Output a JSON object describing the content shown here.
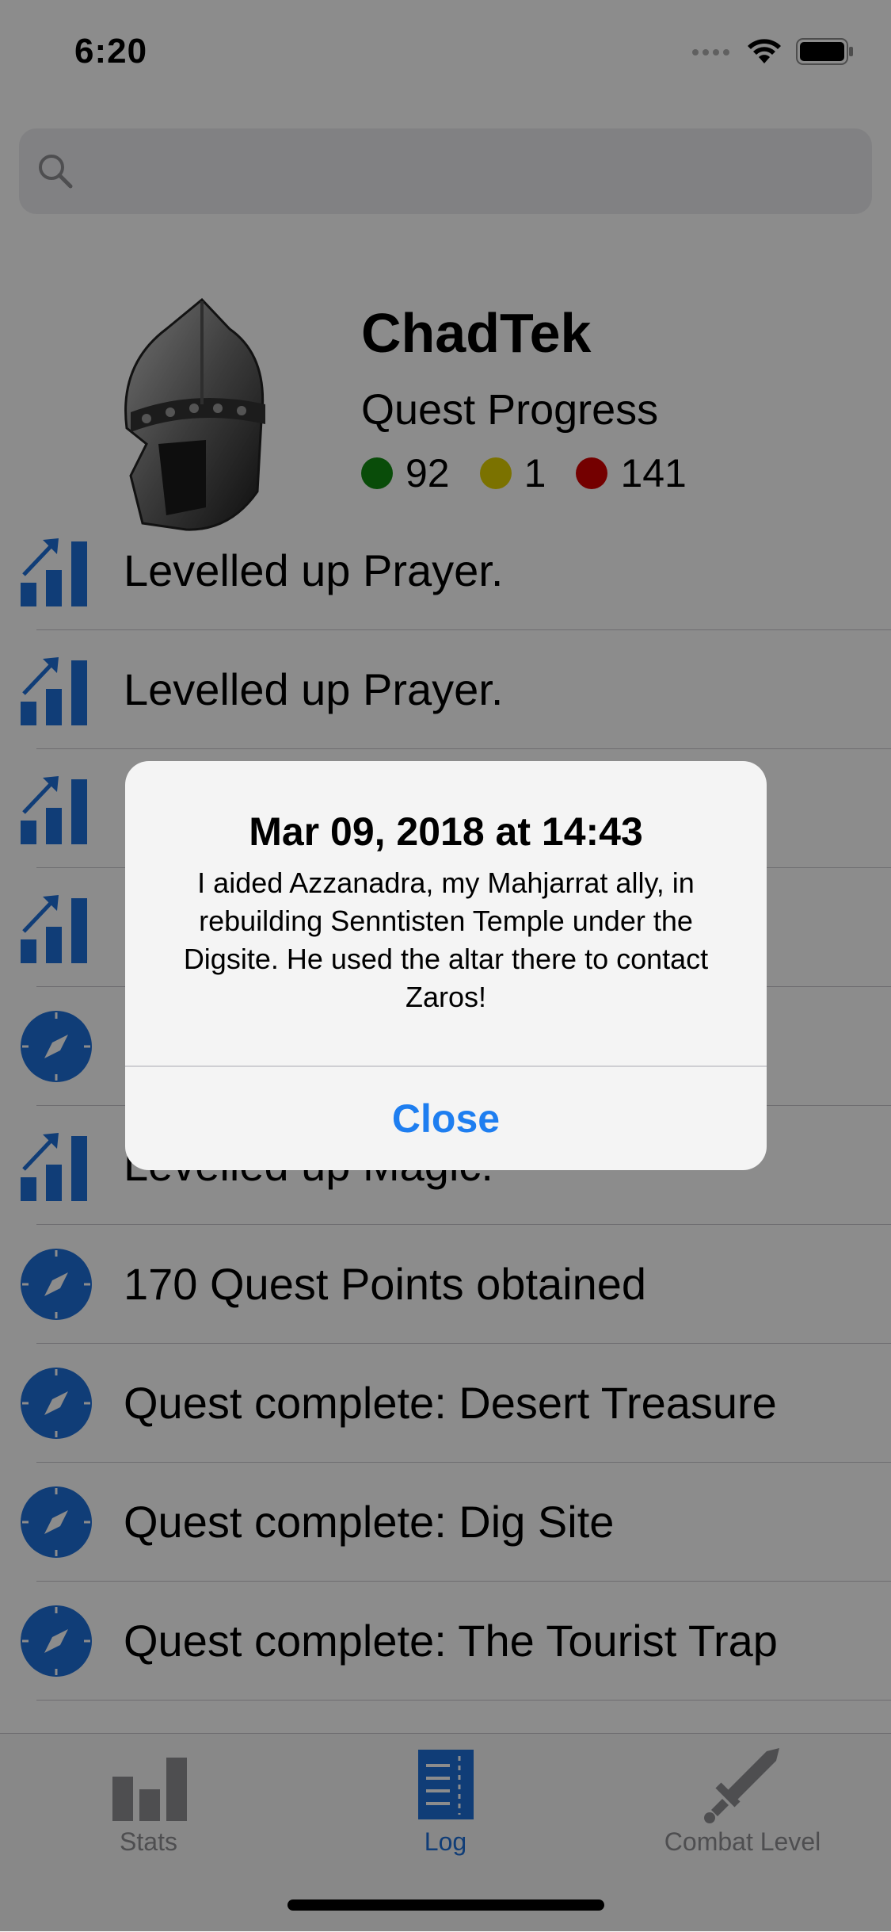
{
  "status_bar": {
    "time": "6:20"
  },
  "search": {
    "placeholder": ""
  },
  "profile": {
    "name": "ChadTek",
    "quest_title": "Quest Progress",
    "counts": [
      {
        "value": "92",
        "color": "#128a12"
      },
      {
        "value": "1",
        "color": "#e0d000"
      },
      {
        "value": "141",
        "color": "#d40000"
      }
    ]
  },
  "log": {
    "items": [
      {
        "icon": "levelup-icon",
        "text": "Levelled up Prayer."
      },
      {
        "icon": "levelup-icon",
        "text": "Levelled up Prayer."
      },
      {
        "icon": "levelup-icon",
        "text": ""
      },
      {
        "icon": "levelup-icon",
        "text": ""
      },
      {
        "icon": "compass-icon",
        "text": ""
      },
      {
        "icon": "levelup-icon",
        "text": "Levelled up Magic."
      },
      {
        "icon": "compass-icon",
        "text": "170 Quest Points obtained"
      },
      {
        "icon": "compass-icon",
        "text": "Quest complete: Desert Treasure"
      },
      {
        "icon": "compass-icon",
        "text": "Quest complete: Dig Site"
      },
      {
        "icon": "compass-icon",
        "text": "Quest complete: The Tourist Trap"
      }
    ]
  },
  "tabs": [
    {
      "label": "Stats",
      "icon": "stats-icon",
      "active": false
    },
    {
      "label": "Log",
      "icon": "log-icon",
      "active": true
    },
    {
      "label": "Combat Level",
      "icon": "sword-icon",
      "active": false
    }
  ],
  "alert": {
    "title": "Mar 09, 2018 at 14:43",
    "message": "I aided Azzanadra, my Mahjarrat ally, in rebuilding Senntisten Temple under the Digsite. He used the altar there to contact Zaros!",
    "close_label": "Close"
  },
  "colors": {
    "accent": "#1e6fd9",
    "alert_button": "#1e7ef0"
  }
}
